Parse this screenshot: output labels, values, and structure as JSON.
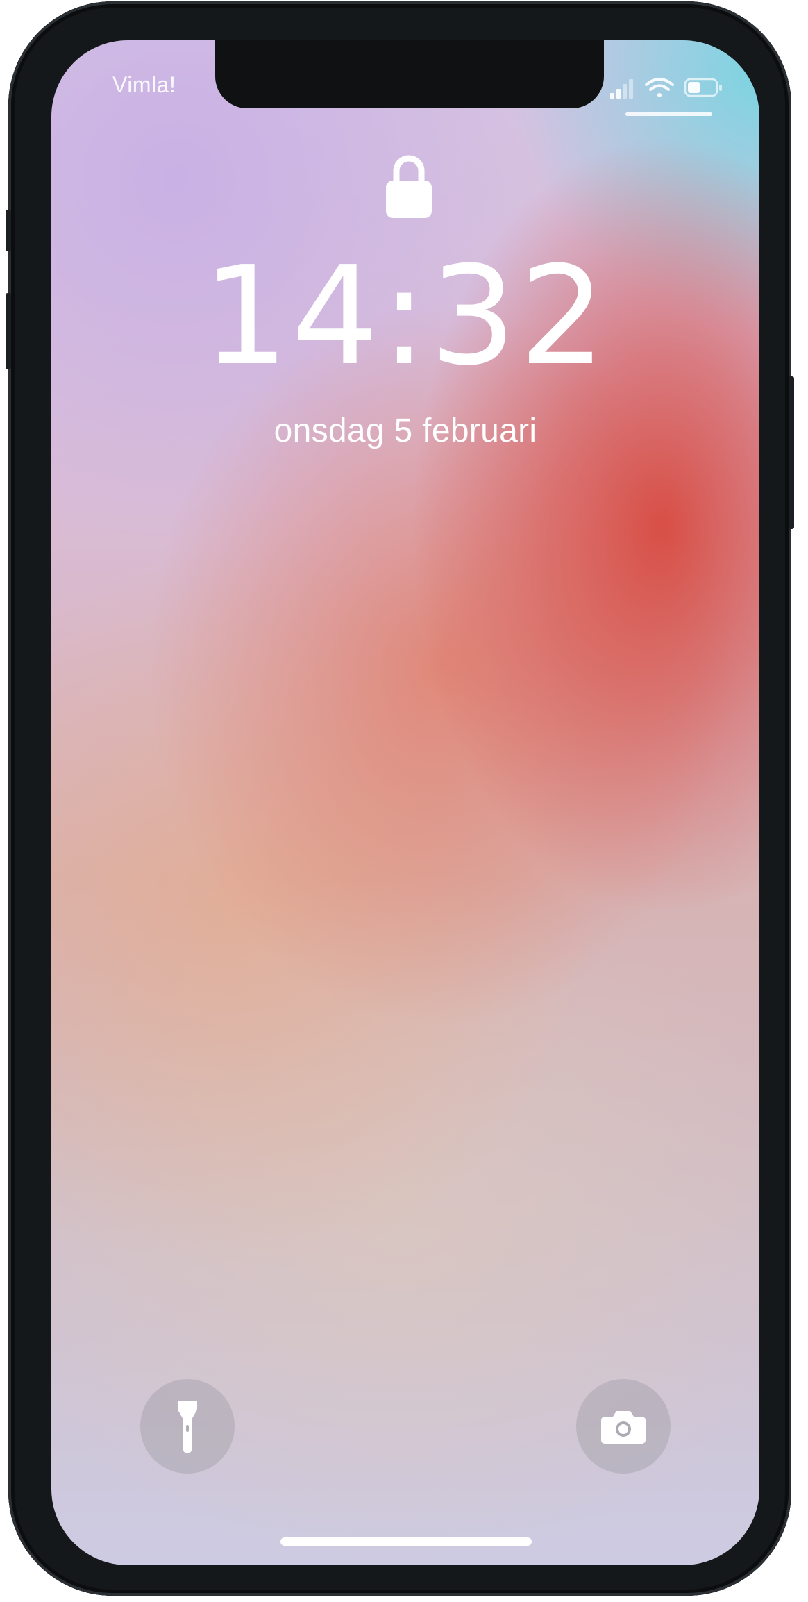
{
  "status_bar": {
    "carrier": "Vimla!",
    "icons": [
      "cellular-signal-icon",
      "wifi-icon",
      "battery-icon"
    ]
  },
  "lock_screen": {
    "lock_icon": "lock-icon",
    "time": "14:32",
    "date": "onsdag 5 februari"
  },
  "quick_actions": {
    "left": "flashlight-icon",
    "right": "camera-icon"
  },
  "colors": {
    "wallpaper_accent": "#d8463a",
    "wallpaper_corner": "#6ed7e1",
    "text": "#ffffff",
    "frame": "#15181b"
  }
}
